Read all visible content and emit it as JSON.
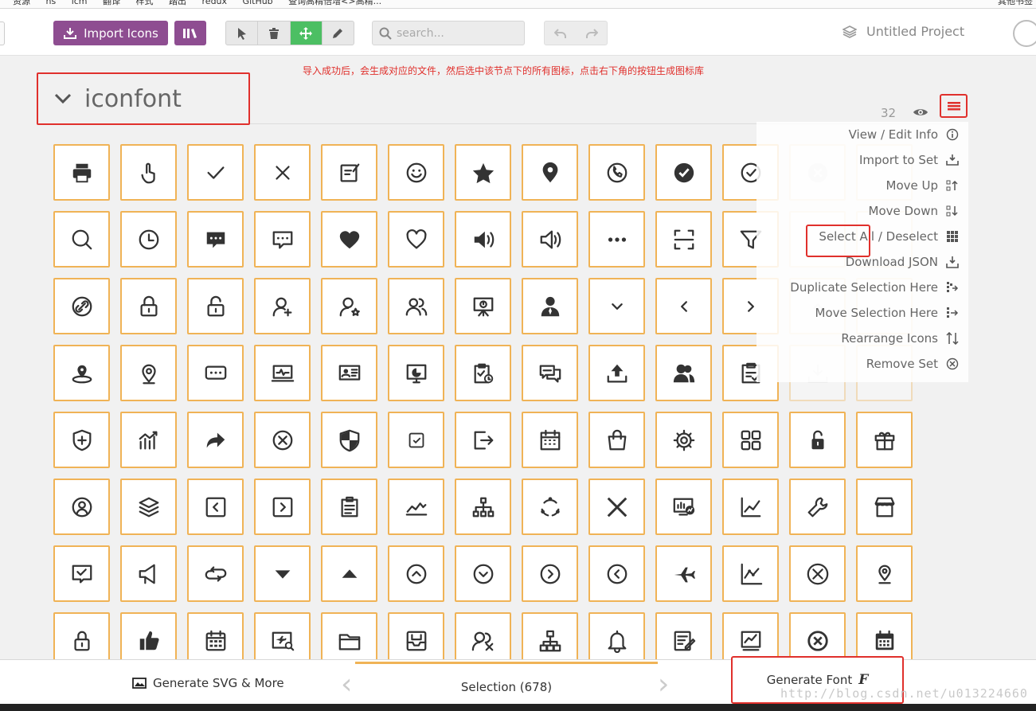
{
  "bookmarks": [
    "资源",
    "ns",
    "icm",
    "翻译",
    "样式",
    "踏出",
    "redux",
    "GitHub",
    "查询高精倍增<>高精..."
  ],
  "bookmarks_right": "其他书签",
  "toolbar": {
    "import_label": "Import Icons",
    "search_placeholder": "search...",
    "project_title": "Untitled Project"
  },
  "annotation": "导入成功后，会生成对应的文件，然后选中该节点下的所有图标，点击右下角的按钮生成图标库",
  "set": {
    "name": "iconfont",
    "count": "32"
  },
  "menu": [
    {
      "label": "View / Edit Info",
      "icon": "info-icon"
    },
    {
      "label": "Import to Set",
      "icon": "import-icon"
    },
    {
      "label": "Move Up",
      "icon": "move-up-icon"
    },
    {
      "label": "Move Down",
      "icon": "move-down-icon"
    },
    {
      "label": "Select All / Deselect",
      "icon": "select-all-icon"
    },
    {
      "label": "Download JSON",
      "icon": "download-icon"
    },
    {
      "label": "Duplicate Selection Here",
      "icon": "duplicate-icon"
    },
    {
      "label": "Move Selection Here",
      "icon": "move-selection-icon"
    },
    {
      "label": "Rearrange Icons",
      "icon": "rearrange-icon"
    },
    {
      "label": "Remove Set",
      "icon": "remove-icon"
    }
  ],
  "icons": [
    "printer",
    "hand-pointer",
    "check",
    "close",
    "edit",
    "smile",
    "star-filled",
    "location-filled",
    "phone-circle",
    "check-circle-filled",
    "check-circle",
    "close-circle-faded",
    "faded",
    "search",
    "clock",
    "message-filled",
    "message",
    "heart-filled",
    "heart",
    "volume-filled",
    "volume",
    "more",
    "scan",
    "filter",
    "faded",
    "faded",
    "link-circle",
    "lock",
    "unlock",
    "user-add",
    "user-star",
    "users",
    "presentation",
    "user-filled",
    "chevron-down",
    "chevron-left",
    "chevron-right",
    "chevron-up-faded",
    "faded",
    "map-pin-ring",
    "map-pin",
    "chat-dots",
    "monitor-pulse",
    "id-card",
    "chart-screen",
    "clipboard-time",
    "chat-double",
    "upload-tray",
    "users-filled",
    "clipboard-check",
    "download-faded",
    "faded",
    "shield-plus",
    "growth-chart",
    "share-arrow",
    "close-circle",
    "shield-half",
    "checkbox",
    "logout",
    "calendar",
    "shopping-bag",
    "gear",
    "apps",
    "lock-filled",
    "gift",
    "user-circle",
    "layers",
    "square-left",
    "square-right",
    "clipboard-list",
    "line-chart",
    "org-chart",
    "loading-circle",
    "big-x",
    "monitor-chart",
    "trend-chart",
    "wrench",
    "store",
    "message-check",
    "megaphone",
    "loop",
    "triangle-down",
    "triangle-up",
    "circle-up",
    "circle-down",
    "circle-right",
    "circle-left",
    "airplane",
    "trend-line",
    "x-circle-big",
    "location-pin",
    "padlock",
    "thumbs-up",
    "calendar-grid",
    "ticket",
    "folder",
    "inbox",
    "user-tools",
    "hierarchy",
    "bell",
    "note-edit",
    "screen-graph",
    "x-circle-bold",
    "calendar-filled"
  ],
  "bottombar": {
    "generate_svg": "Generate SVG & More",
    "selection": "Selection (678)",
    "generate_font": "Generate Font"
  },
  "watermark": "http://blog.csdn.net/u013224660"
}
